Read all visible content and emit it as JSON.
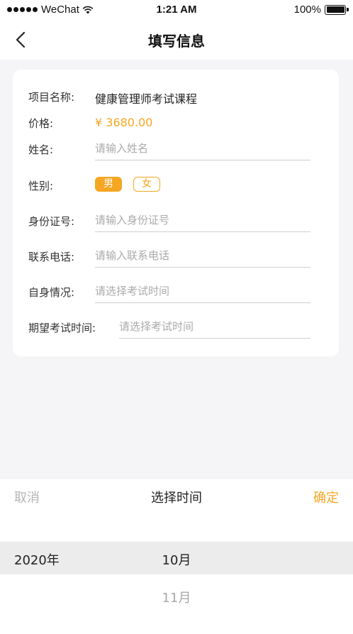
{
  "status_bar": {
    "carrier": "WeChat",
    "time": "1:21 AM",
    "battery": "100%",
    "battery_level": 1.0
  },
  "nav": {
    "title": "填写信息",
    "back_icon": "chevron-left-icon"
  },
  "form": {
    "project_label": "项目名称:",
    "project_value": "健康管理师考试课程",
    "price_label": "价格:",
    "price_value": "¥ 3680.00",
    "name_label": "姓名:",
    "name_placeholder": "请输入姓名",
    "gender_label": "性别:",
    "gender_options": [
      "男",
      "女"
    ],
    "gender_selected": "男",
    "id_label": "身份证号:",
    "id_placeholder": "请输入身份证号",
    "phone_label": "联系电话:",
    "phone_placeholder": "请输入联系电话",
    "situation_label": "自身情况:",
    "situation_placeholder": "请选择考试时间",
    "exam_time_label": "期望考试时间:",
    "exam_time_placeholder": "请选择考试时间"
  },
  "picker": {
    "cancel": "取消",
    "title": "选择时间",
    "confirm": "确定",
    "year_selected": "2020年",
    "month_selected": "10月",
    "month_next": "11月"
  },
  "colors": {
    "accent": "#f5a623",
    "background": "#f5f5f7"
  }
}
